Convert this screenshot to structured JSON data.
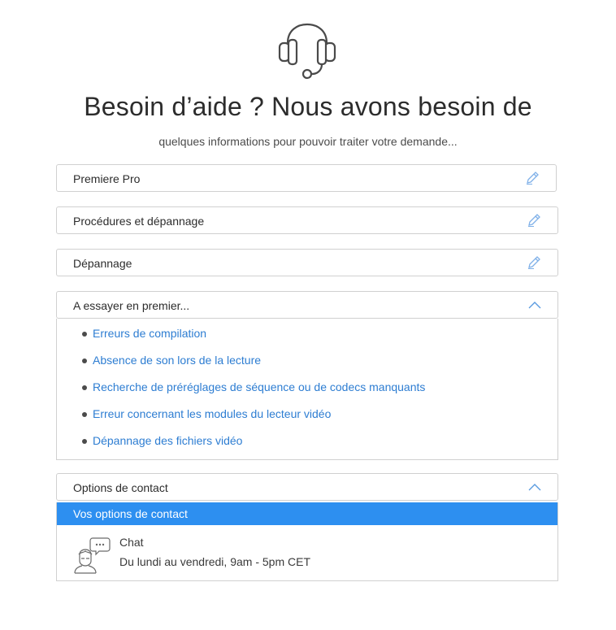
{
  "header": {
    "title": "Besoin d’aide ? Nous avons besoin de",
    "subtitle": "quelques informations pour pouvoir traiter votre demande..."
  },
  "fields": {
    "product": "Premiere Pro",
    "category": "Procédures et dépannage",
    "topic": "Dépannage"
  },
  "try_first": {
    "label": "A essayer en premier...",
    "links": [
      "Erreurs de compilation",
      "Absence de son lors de la lecture",
      "Recherche de préréglages de séquence ou de codecs manquants",
      "Erreur concernant les modules du lecteur vidéo",
      "Dépannage des fichiers vidéo"
    ]
  },
  "contact": {
    "label": "Options de contact",
    "bar_label": "Vos options de contact",
    "chat": {
      "name": "Chat",
      "hours": "Du lundi au vendredi, 9am - 5pm CET"
    }
  },
  "icons": {
    "header": "headset-icon",
    "edit": "pencil-icon",
    "collapse": "chevron-up-icon",
    "chat": "chat-agent-icon"
  },
  "colors": {
    "link": "#2d7dd2",
    "accent": "#2d8ff0",
    "border": "#d0d0d0",
    "text": "#2c2c2c"
  }
}
